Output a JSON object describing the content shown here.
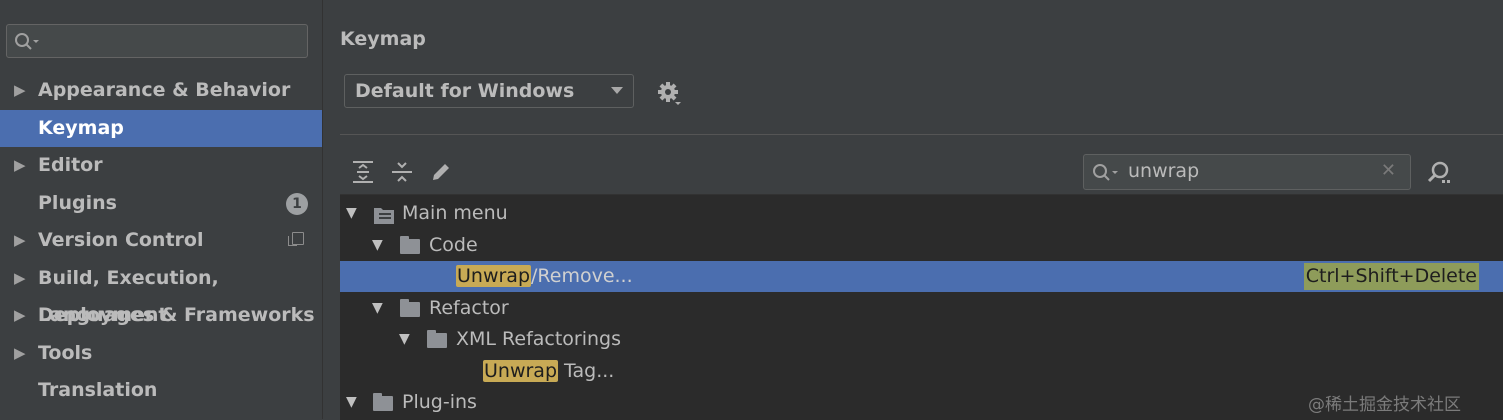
{
  "sidebar": {
    "items": [
      {
        "label": "Appearance & Behavior",
        "arrow": "▶"
      },
      {
        "label": "Keymap"
      },
      {
        "label": "Editor",
        "arrow": "▶"
      },
      {
        "label": "Plugins",
        "badge": "1"
      },
      {
        "label": "Version Control",
        "arrow": "▶"
      },
      {
        "label": "Build, Execution, Deployment",
        "arrow": "▶"
      },
      {
        "label": "Languages & Frameworks",
        "arrow": "▶"
      },
      {
        "label": "Tools",
        "arrow": "▶"
      },
      {
        "label": "Translation"
      }
    ]
  },
  "main": {
    "title": "Keymap",
    "keymap_select": "Default for Windows",
    "filter_value": "unwrap",
    "clear_glyph": "✕"
  },
  "tree": {
    "main_menu": "Main menu",
    "code": "Code",
    "unwrap_hl": "Unwrap",
    "unwrap_rest": "/Remove...",
    "unwrap_shortcut": "Ctrl+Shift+Delete",
    "refactor": "Refactor",
    "xml_refactorings": "XML Refactorings",
    "tag_hl": "Unwrap",
    "tag_rest": " Tag...",
    "plugins": "Plug-ins",
    "expanded_glyph": "▼"
  },
  "watermark": "@稀土掘金技术社区",
  "colors": {
    "selection": "#4b6eaf",
    "highlight": "#c8aa55",
    "shortcut": "#8e9c5a"
  }
}
